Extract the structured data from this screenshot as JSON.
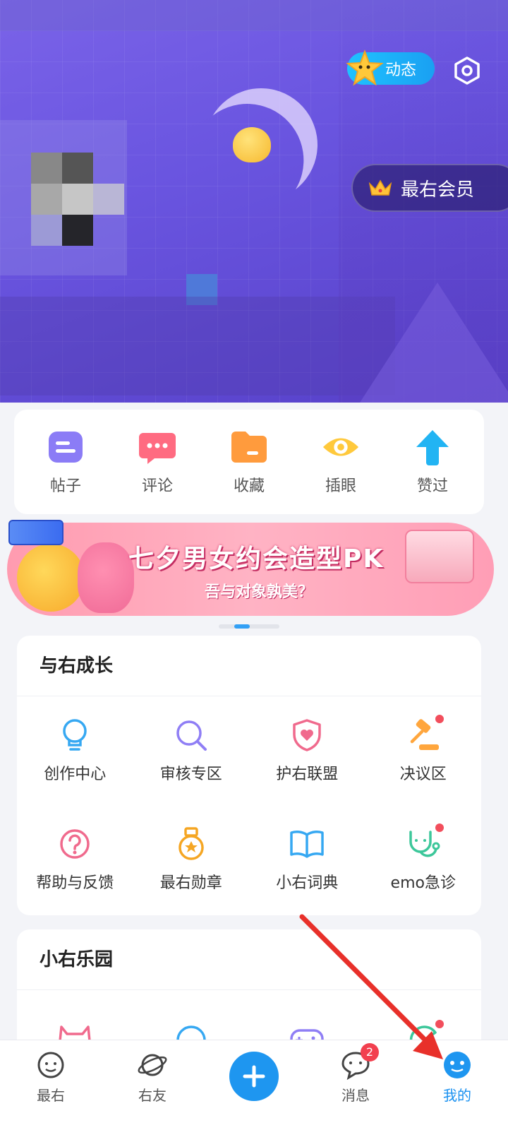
{
  "header": {
    "dynamic_label": "动态",
    "vip_label": "最右会员"
  },
  "quick_actions": [
    {
      "label": "帖子",
      "icon": "post-icon",
      "color": "#8b7cf6"
    },
    {
      "label": "评论",
      "icon": "comment-icon",
      "color": "#ff6b81"
    },
    {
      "label": "收藏",
      "icon": "folder-icon",
      "color": "#ff9b3d"
    },
    {
      "label": "插眼",
      "icon": "eye-icon",
      "color": "#ffc93c"
    },
    {
      "label": "赞过",
      "icon": "thumb-up-arrow-icon",
      "color": "#22b4f3"
    }
  ],
  "banner": {
    "title": "七夕男女约会造型PK",
    "subtitle": "吾与对象孰美？"
  },
  "growth": {
    "title": "与右成长",
    "items": [
      {
        "label": "创作中心",
        "icon": "lightbulb-icon",
        "color": "#36a8f2",
        "dot": false
      },
      {
        "label": "审核专区",
        "icon": "magnifier-icon",
        "color": "#8f7ef5",
        "dot": false
      },
      {
        "label": "护右联盟",
        "icon": "shield-heart-icon",
        "color": "#f06a8d",
        "dot": false
      },
      {
        "label": "决议区",
        "icon": "gavel-icon",
        "color": "#ffa63d",
        "dot": true
      },
      {
        "label": "帮助与反馈",
        "icon": "question-icon",
        "color": "#f06a8d",
        "dot": false
      },
      {
        "label": "最右勋章",
        "icon": "medal-icon",
        "color": "#f5a623",
        "dot": false
      },
      {
        "label": "小右词典",
        "icon": "book-icon",
        "color": "#36a8f2",
        "dot": false
      },
      {
        "label": "emo急诊",
        "icon": "stethoscope-icon",
        "color": "#3cc79a",
        "dot": true
      }
    ]
  },
  "park": {
    "title": "小右乐园",
    "items": [
      {
        "icon": "devil-cat-icon",
        "color": "#f06a8d",
        "dot": false
      },
      {
        "icon": "smile-face-icon",
        "color": "#36a8f2",
        "dot": false
      },
      {
        "icon": "gamepad-icon",
        "color": "#8f7ef5",
        "dot": false
      },
      {
        "icon": "pacman-icon",
        "color": "#3cc79a",
        "dot": true
      }
    ]
  },
  "tabbar": {
    "tabs": [
      {
        "label": "最右",
        "icon": "home-face-icon"
      },
      {
        "label": "右友",
        "icon": "planet-icon"
      },
      {
        "label": "消息",
        "icon": "message-icon",
        "badge": "2"
      },
      {
        "label": "我的",
        "icon": "profile-icon"
      }
    ]
  },
  "colors": {
    "accent": "#1e96f0",
    "badge": "#f2404f",
    "annotation_arrow": "#e8302a"
  }
}
